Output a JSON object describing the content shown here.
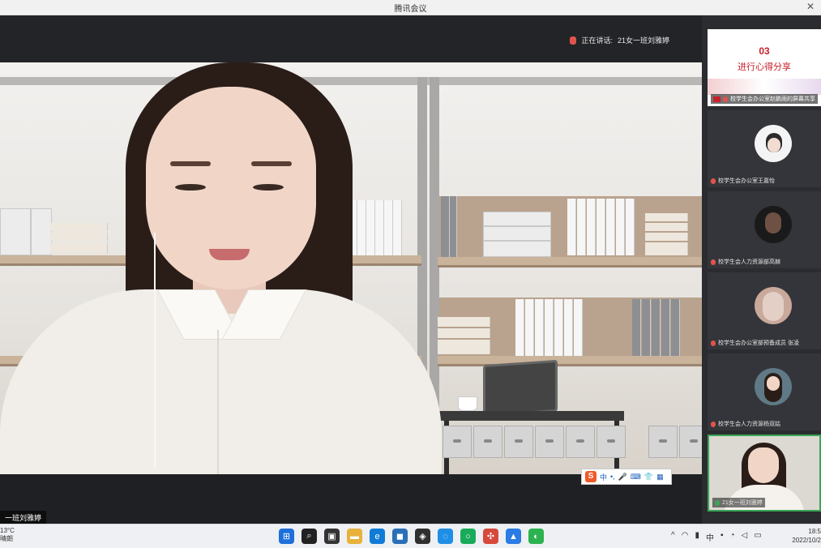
{
  "window": {
    "title": "腾讯会议",
    "close_glyph": "✕"
  },
  "speaker": {
    "prefix": "正在讲话:",
    "name": "21女一班刘雅婷"
  },
  "main_video": {
    "name_label": "一班刘雅婷"
  },
  "ime_toolbar": {
    "logo": "S",
    "mode": "中",
    "punct": "•,",
    "mic": "🎤",
    "kbd": "⌨",
    "skin": "👕",
    "tools": "▦"
  },
  "participants": [
    {
      "label": "校学生会办公室赵鹏雨的屏幕共享",
      "type": "screen-share",
      "slide_number": "03",
      "slide_title": "进行心得分享",
      "mic": "muted"
    },
    {
      "label": "校学生会办公室王嘉怡",
      "mic": "muted",
      "avatar_color": "#f4f4f4"
    },
    {
      "label": "校学生会人力资源部高赫",
      "mic": "muted",
      "avatar_color": "#1a1a1a"
    },
    {
      "label": "校学生会办公室部预备成员 张凌",
      "mic": "muted",
      "avatar_color": "#c9a99b"
    },
    {
      "label": "校学生会人力资源杨双姑",
      "mic": "muted",
      "avatar_color": "#5f7a86"
    },
    {
      "label": "21女一班刘雅婷",
      "mic": "active",
      "type": "self"
    }
  ],
  "taskbar": {
    "weather_temp": "13°C",
    "weather_desc": "晴朗",
    "apps": [
      {
        "name": "windows-start",
        "glyph": "⊞",
        "color": "#1e6fd9"
      },
      {
        "name": "search",
        "glyph": "⌕",
        "color": "#222222"
      },
      {
        "name": "task-view",
        "glyph": "▣",
        "color": "#333333"
      },
      {
        "name": "file-explorer",
        "glyph": "▬",
        "color": "#e8b23a"
      },
      {
        "name": "edge",
        "glyph": "e",
        "color": "#0f7bd6"
      },
      {
        "name": "store",
        "glyph": "◼",
        "color": "#2a6fb8"
      },
      {
        "name": "app-dark",
        "glyph": "◈",
        "color": "#2f2f2f"
      },
      {
        "name": "app-blue",
        "glyph": "◌",
        "color": "#1f8fe5"
      },
      {
        "name": "app-green",
        "glyph": "○",
        "color": "#1aab5a"
      },
      {
        "name": "app-colorful",
        "glyph": "✣",
        "color": "#d6493b"
      },
      {
        "name": "tencent-meeting",
        "glyph": "▲",
        "color": "#2a7be4"
      },
      {
        "name": "wechat",
        "glyph": "◐",
        "color": "#2bb34f"
      }
    ],
    "tray_chevron": "^",
    "time": "18:5",
    "date": "2022/10/2"
  }
}
